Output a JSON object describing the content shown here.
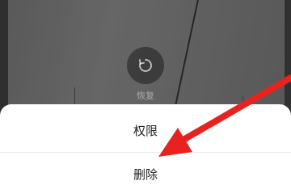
{
  "background": {
    "restore_label": "恢复",
    "icon": "restore-icon"
  },
  "action_sheet": {
    "items": [
      {
        "label": "权限"
      },
      {
        "label": "删除"
      }
    ]
  },
  "annotation": {
    "arrow_color": "#e8231f",
    "icon": "arrow-pointer"
  }
}
